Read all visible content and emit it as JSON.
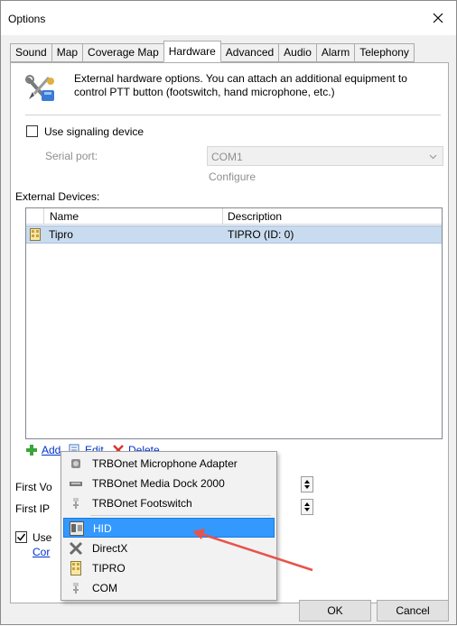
{
  "window": {
    "title": "Options"
  },
  "tabs": [
    "Sound",
    "Map",
    "Coverage Map",
    "Hardware",
    "Advanced",
    "Audio",
    "Alarm",
    "Telephony"
  ],
  "active_tab": "Hardware",
  "hardware": {
    "description": "External hardware options. You can attach an additional equipment to control PTT button (footswitch, hand microphone, etc.)",
    "use_signaling_label": "Use signaling device",
    "use_signaling_checked": false,
    "serial_port_label": "Serial port:",
    "serial_port_value": "COM1",
    "configure_label": "Configure",
    "external_devices_label": "External Devices:",
    "columns": [
      "Name",
      "Description"
    ],
    "devices": [
      {
        "name": "Tipro",
        "description": "TIPRO (ID: 0)"
      }
    ],
    "actions": {
      "add": "Add",
      "edit": "Edit",
      "delete": "Delete"
    },
    "first_voice_label": "First Vo",
    "first_ip_label": "First IP",
    "use_label": "Use",
    "use_checked": true,
    "config_link": "Cor"
  },
  "context_menu": {
    "items": [
      {
        "label": "TRBOnet Microphone Adapter",
        "icon": "microphone-icon"
      },
      {
        "label": "TRBOnet Media Dock 2000",
        "icon": "dock-icon"
      },
      {
        "label": "TRBOnet Footswitch",
        "icon": "footswitch-icon"
      },
      {
        "label": "HID",
        "icon": "hid-icon",
        "highlighted": true
      },
      {
        "label": "DirectX",
        "icon": "directx-icon"
      },
      {
        "label": "TIPRO",
        "icon": "tipro-icon"
      },
      {
        "label": "COM",
        "icon": "com-icon"
      }
    ]
  },
  "buttons": {
    "ok": "OK",
    "cancel": "Cancel"
  },
  "colors": {
    "highlight": "#3399ff",
    "selection_row": "#c9dbee",
    "annotation_arrow": "#e8534a",
    "link": "#0033cc"
  }
}
